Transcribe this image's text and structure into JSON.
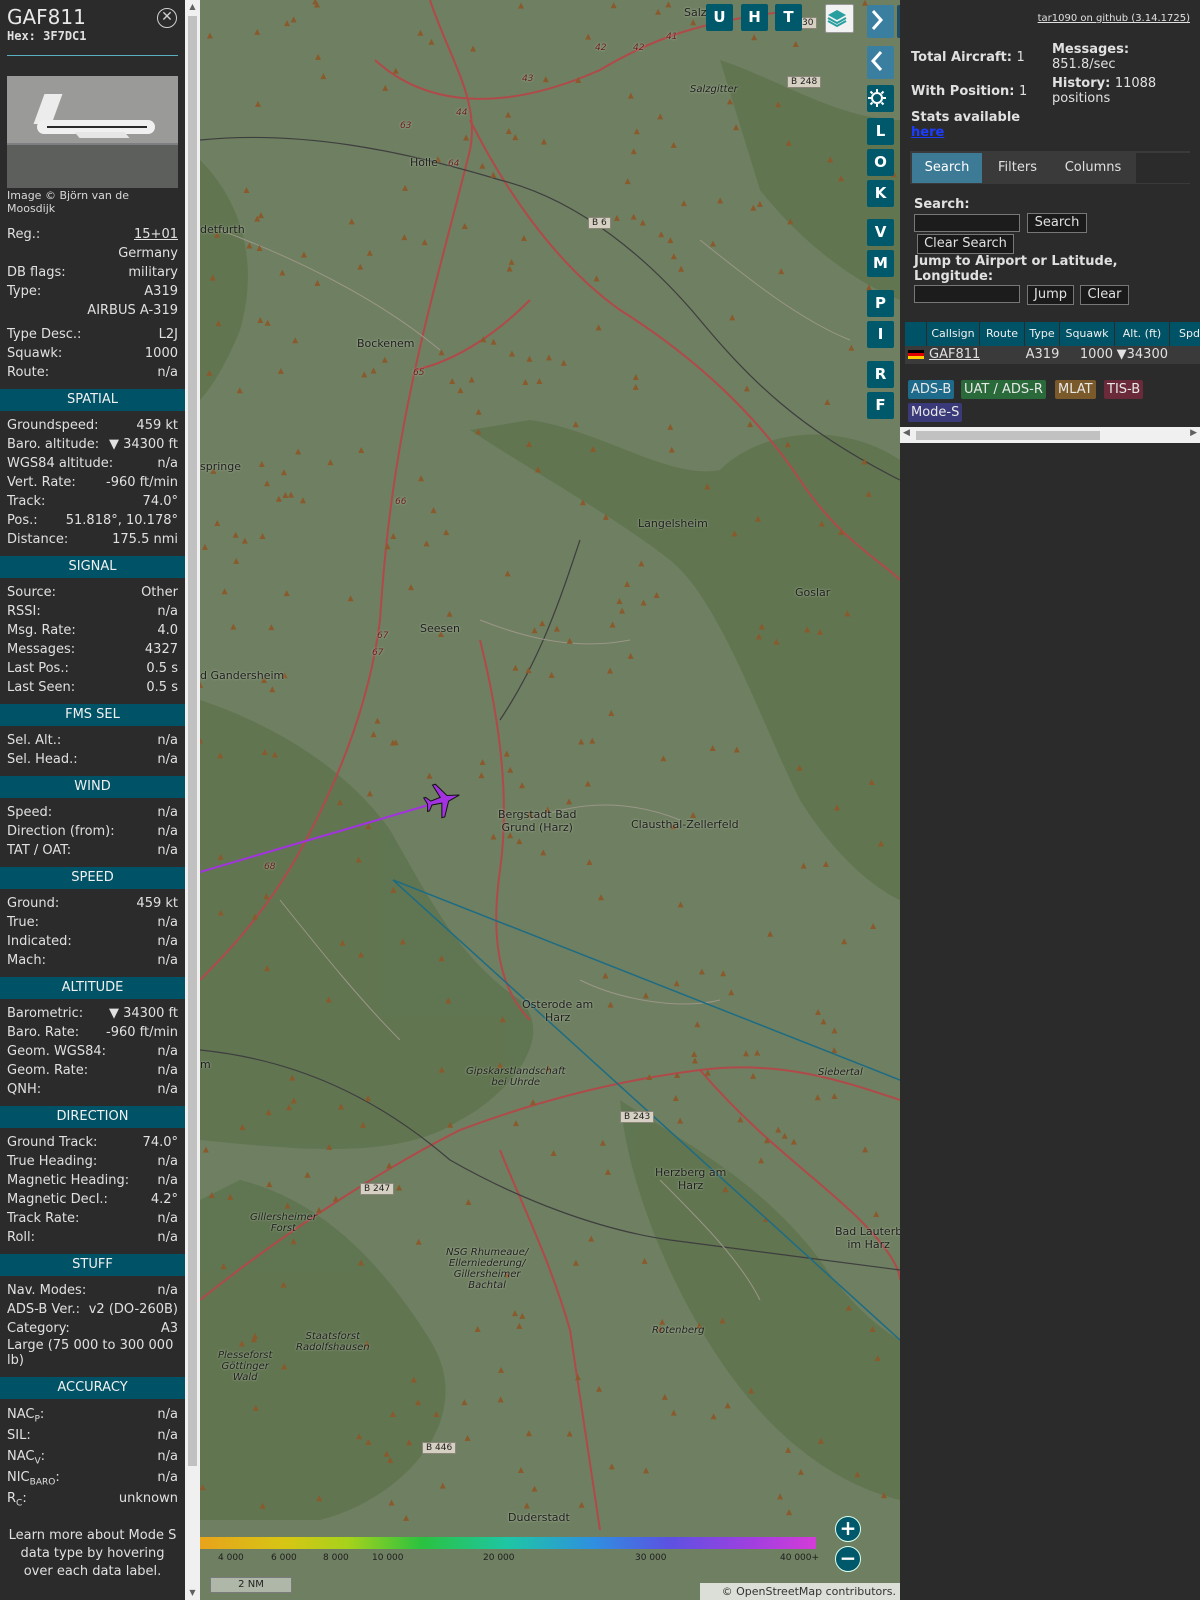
{
  "aircraft": {
    "callsign": "GAF811",
    "hex_label": "Hex:",
    "hex": "3F7DC1",
    "photo_credit": "Image © Björn van de Moosdijk",
    "reg_label": "Reg.:",
    "reg": "15+01",
    "country": "Germany",
    "dbflags_label": "DB flags:",
    "dbflags": "military",
    "type_label": "Type:",
    "type": "A319",
    "type_name": "AIRBUS A-319",
    "typedesc_label": "Type Desc.:",
    "typedesc": "L2J",
    "squawk_label": "Squawk:",
    "squawk": "1000",
    "route_label": "Route:",
    "route": "n/a"
  },
  "sections": {
    "spatial": "SPATIAL",
    "signal": "SIGNAL",
    "fms": "FMS SEL",
    "wind": "WIND",
    "speed": "SPEED",
    "altitude": "ALTITUDE",
    "direction": "DIRECTION",
    "stuff": "STUFF",
    "accuracy": "ACCURACY"
  },
  "spatial": [
    {
      "k": "Groundspeed:",
      "v": "459 kt"
    },
    {
      "k": "Baro. altitude:",
      "v": "▼ 34300 ft"
    },
    {
      "k": "WGS84 altitude:",
      "v": "n/a"
    },
    {
      "k": "Vert. Rate:",
      "v": "-960 ft/min"
    },
    {
      "k": "Track:",
      "v": "74.0°"
    },
    {
      "k": "Pos.:",
      "v": "51.818°, 10.178°"
    },
    {
      "k": "Distance:",
      "v": "175.5 nmi"
    }
  ],
  "signal": [
    {
      "k": "Source:",
      "v": "Other"
    },
    {
      "k": "RSSI:",
      "v": "n/a"
    },
    {
      "k": "Msg. Rate:",
      "v": "4.0"
    },
    {
      "k": "Messages:",
      "v": "4327"
    },
    {
      "k": "Last Pos.:",
      "v": "0.5 s"
    },
    {
      "k": "Last Seen:",
      "v": "0.5 s"
    }
  ],
  "fms": [
    {
      "k": "Sel. Alt.:",
      "v": "n/a"
    },
    {
      "k": "Sel. Head.:",
      "v": "n/a"
    }
  ],
  "wind": [
    {
      "k": "Speed:",
      "v": "n/a"
    },
    {
      "k": "Direction (from):",
      "v": "n/a"
    },
    {
      "k": "TAT / OAT:",
      "v": "n/a"
    }
  ],
  "speed": [
    {
      "k": "Ground:",
      "v": "459 kt"
    },
    {
      "k": "True:",
      "v": "n/a"
    },
    {
      "k": "Indicated:",
      "v": "n/a"
    },
    {
      "k": "Mach:",
      "v": "n/a"
    }
  ],
  "altitude": [
    {
      "k": "Barometric:",
      "v": "▼ 34300 ft"
    },
    {
      "k": "Baro. Rate:",
      "v": "-960 ft/min"
    },
    {
      "k": "Geom. WGS84:",
      "v": "n/a"
    },
    {
      "k": "Geom. Rate:",
      "v": "n/a"
    },
    {
      "k": "QNH:",
      "v": "n/a"
    }
  ],
  "direction": [
    {
      "k": "Ground Track:",
      "v": "74.0°"
    },
    {
      "k": "True Heading:",
      "v": "n/a"
    },
    {
      "k": "Magnetic Heading:",
      "v": "n/a"
    },
    {
      "k": "Magnetic Decl.:",
      "v": "4.2°"
    },
    {
      "k": "Track Rate:",
      "v": "n/a"
    },
    {
      "k": "Roll:",
      "v": "n/a"
    }
  ],
  "stuff": [
    {
      "k": "Nav. Modes:",
      "v": "n/a"
    },
    {
      "k": "ADS-B Ver.:",
      "v": "v2 (DO-260B)"
    },
    {
      "k": "Category:",
      "v": "A3"
    }
  ],
  "stuff_category_desc": "Large (75 000 to 300 000 lb)",
  "accuracy": [
    {
      "k": "NAC",
      "sub": "P",
      "v": "n/a"
    },
    {
      "k": "SIL:",
      "sub": "",
      "v": "n/a"
    },
    {
      "k": "NAC",
      "sub": "V",
      "v": "n/a"
    },
    {
      "k": "NIC",
      "sub": "BARO",
      "v": "n/a"
    },
    {
      "k": "R",
      "sub": "C",
      "v": "unknown"
    }
  ],
  "footer_note": "Learn more about Mode S data type by hovering over each data label.",
  "map": {
    "top_buttons": [
      "U",
      "H",
      "T"
    ],
    "side_buttons": [
      "L",
      "O",
      "K",
      "V",
      "M",
      "P",
      "I",
      "R",
      "F"
    ],
    "towns": [
      "Salzgitter",
      "Holle",
      "Bockenem",
      "detfurth",
      "springe",
      "Langelsheim",
      "Goslar",
      "Seesen",
      "d Gandersheim",
      "Bergstadt Bad",
      "Grund (Harz)",
      "Clausthal-Zellerfeld",
      "Osterode am",
      "Harz",
      "Herzberg am",
      "Harz",
      "Bad Lauterb",
      "im Harz",
      "Duderstadt",
      "Siebertal",
      "Gipskarstlandschaft",
      "bei Uhrde",
      "Gillersheimer",
      "Forst",
      "NSG Rhumeaue/",
      "Ellerniederung/",
      "Gillersheimer",
      "Bachtal",
      "Staatsforst",
      "Radolfshausen",
      "Plesseforst",
      "Göttinger",
      "Wald",
      "Rotenberg",
      "m",
      "Salz"
    ],
    "roads": [
      "B 248",
      "B 6",
      "B 243",
      "B 247",
      "B 446",
      "30"
    ],
    "route_numbers": [
      "42",
      "42",
      "41",
      "43",
      "44",
      "63",
      "64",
      "65",
      "66",
      "67",
      "67",
      "68"
    ],
    "colorbar_ticks": [
      "4 000",
      "6 000",
      "8 000",
      "10 000",
      "20 000",
      "30 000",
      "40 000+"
    ],
    "scale": "2 NM",
    "attribution": "© OpenStreetMap contributors.",
    "zoom_in": "+",
    "zoom_out": "−"
  },
  "sidebar": {
    "github": "tar1090 on github (3.14.1725)",
    "total_aircraft_label": "Total Aircraft:",
    "total_aircraft": "1",
    "with_position_label": "With Position:",
    "with_position": "1",
    "messages_label": "Messages:",
    "messages": "851.8/sec",
    "history_label": "History:",
    "history": "11088 positions",
    "stats_label": "Stats available",
    "stats_link": "here",
    "tabs": [
      "Search",
      "Filters",
      "Columns"
    ],
    "search_label": "Search:",
    "search_button": "Search",
    "clear_search": "Clear Search",
    "jump_label": "Jump to Airport or Latitude, Longitude:",
    "jump_button": "Jump",
    "clear_button": "Clear",
    "columns": [
      "Callsign",
      "Route",
      "Type",
      "Squawk",
      "Alt. (ft)",
      "Spd"
    ],
    "row": {
      "callsign": "GAF811",
      "route": "",
      "type": "A319",
      "squawk": "1000",
      "alt": "▼34300",
      "spd": ""
    },
    "badges": [
      "ADS-B",
      "UAT / ADS-R",
      "MLAT",
      "TIS-B",
      "Mode-S"
    ],
    "badge_colors": [
      "#1d6a8a",
      "#2a6a3a",
      "#7a5a2a",
      "#6a2a3a",
      "#3a3a7a"
    ]
  }
}
